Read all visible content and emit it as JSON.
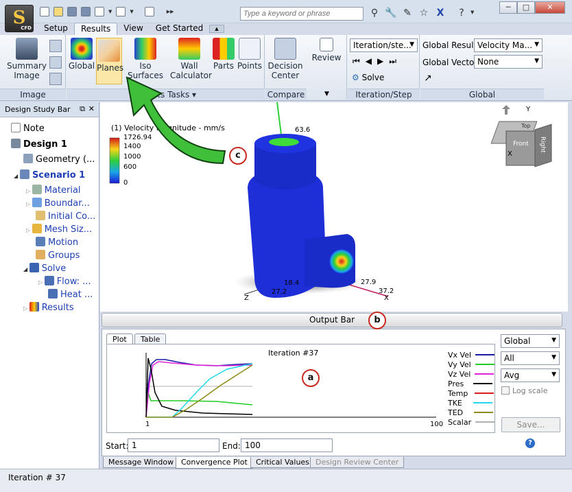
{
  "app": {
    "icon_letter": "S",
    "icon_caption": "CFD"
  },
  "search": {
    "placeholder": "Type a keyword or phrase"
  },
  "tabs": [
    {
      "label": "Setup"
    },
    {
      "label": "Results"
    },
    {
      "label": "View"
    },
    {
      "label": "Get Started"
    }
  ],
  "ribbon": {
    "image": {
      "summary_label": "Summary Image",
      "group_label": "Image"
    },
    "results_tasks": {
      "items": [
        {
          "label": "Global"
        },
        {
          "label": "Planes"
        },
        {
          "label": "Iso Surfaces"
        },
        {
          "label": "Wall Calculator"
        },
        {
          "label": "Parts"
        },
        {
          "label": "Points"
        }
      ],
      "group_label": "Results Tasks"
    },
    "compare": {
      "decision_label": "Decision Center",
      "review_label": "Review",
      "group_label": "Compare"
    },
    "iteration": {
      "combo_value": "Iteration/ste...",
      "solve_label": "Solve",
      "group_label": "Iteration/Step"
    },
    "global": {
      "result_label": "Global Result:",
      "result_value": "Velocity Ma...",
      "vector_label": "Global Vector:",
      "vector_value": "None",
      "group_label": "Global"
    }
  },
  "design_panel": {
    "title": "Design Study Bar",
    "items": [
      {
        "label": "Note"
      },
      {
        "label": "Design 1"
      },
      {
        "label": "Geometry (..."
      },
      {
        "label": "Scenario 1"
      },
      {
        "label": "Material"
      },
      {
        "label": "Boundar..."
      },
      {
        "label": "Initial Co..."
      },
      {
        "label": "Mesh Siz..."
      },
      {
        "label": "Motion"
      },
      {
        "label": "Groups"
      },
      {
        "label": "Solve"
      },
      {
        "label": "Flow: ..."
      },
      {
        "label": "Heat ..."
      },
      {
        "label": "Results"
      }
    ]
  },
  "viewport": {
    "legend_title": "(1) Velocity Magnitude - mm/s",
    "legend_ticks": [
      "1726.94",
      "1400",
      "1000",
      "600",
      "0"
    ],
    "labels": {
      "top": "63.6",
      "a": "27.9",
      "b": "37.2",
      "c": "18.4",
      "d": "27.2"
    },
    "axes": {
      "x": "X",
      "y": "Y",
      "z": "Z"
    },
    "viewcube": {
      "front": "Front",
      "right": "Right",
      "top": "Top"
    }
  },
  "output_bar": {
    "label": "Output Bar"
  },
  "plot": {
    "tabs": [
      {
        "label": "Plot"
      },
      {
        "label": "Table"
      }
    ],
    "iteration_text": "Iteration #37",
    "x_start": "1",
    "x_end": "100",
    "legend": [
      {
        "label": "Vx Vel",
        "color": "#1a1aa8"
      },
      {
        "label": "Vy Vel",
        "color": "#22cc22"
      },
      {
        "label": "Vz Vel",
        "color": "#e020d8"
      },
      {
        "label": "Pres",
        "color": "#000000"
      },
      {
        "label": "Temp",
        "color": "#d81c1c"
      },
      {
        "label": "TKE",
        "color": "#20d8e8"
      },
      {
        "label": "TED",
        "color": "#8a8a14"
      },
      {
        "label": "Scalar",
        "color": "#b0b0b0"
      }
    ],
    "dropdowns": [
      "Global",
      "All",
      "Avg"
    ],
    "log_scale": "Log scale",
    "save": "Save...",
    "start_label": "Start:",
    "start_value": "1",
    "end_label": "End:",
    "end_value": "100"
  },
  "bottom_tabs": [
    {
      "label": "Message Window"
    },
    {
      "label": "Convergence Plot"
    },
    {
      "label": "Critical Values"
    },
    {
      "label": "Design Review Center"
    }
  ],
  "status": {
    "text": "Iteration # 37"
  },
  "callouts": {
    "a": "a",
    "b": "b",
    "c": "c"
  }
}
